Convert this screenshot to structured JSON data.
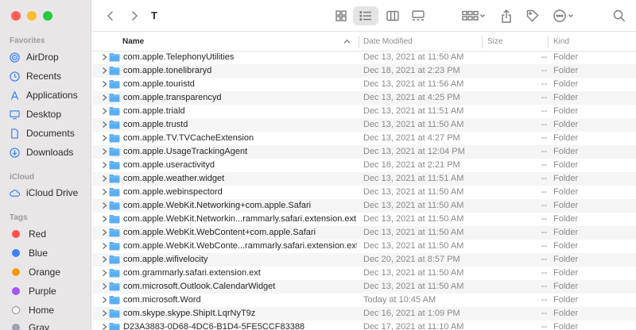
{
  "window": {
    "title": "T"
  },
  "sidebar": {
    "favorites_label": "Favorites",
    "favorites": [
      {
        "label": "AirDrop",
        "icon": "airdrop-icon"
      },
      {
        "label": "Recents",
        "icon": "clock-icon"
      },
      {
        "label": "Applications",
        "icon": "applications-icon"
      },
      {
        "label": "Desktop",
        "icon": "desktop-icon"
      },
      {
        "label": "Documents",
        "icon": "document-icon"
      },
      {
        "label": "Downloads",
        "icon": "download-icon"
      }
    ],
    "icloud_label": "iCloud",
    "icloud": [
      {
        "label": "iCloud Drive",
        "icon": "cloud-icon"
      }
    ],
    "tags_label": "Tags",
    "tags": [
      {
        "label": "Red",
        "color": "#ff4f4a"
      },
      {
        "label": "Blue",
        "color": "#3b82f6"
      },
      {
        "label": "Orange",
        "color": "#f59e0b"
      },
      {
        "label": "Purple",
        "color": "#a855f7"
      },
      {
        "label": "Home",
        "color": "#ffffff"
      },
      {
        "label": "Gray",
        "color": "#9ca3af"
      }
    ]
  },
  "columns": {
    "name": "Name",
    "date": "Date Modified",
    "size": "Size",
    "kind": "Kind"
  },
  "rows": [
    {
      "name": "com.apple.TelephonyUtilities",
      "date": "Dec 13, 2021 at 11:50 AM",
      "size": "--",
      "kind": "Folder"
    },
    {
      "name": "com.apple.tonelibraryd",
      "date": "Dec 18, 2021 at 2:23 PM",
      "size": "--",
      "kind": "Folder"
    },
    {
      "name": "com.apple.touristd",
      "date": "Dec 13, 2021 at 11:56 AM",
      "size": "--",
      "kind": "Folder"
    },
    {
      "name": "com.apple.transparencyd",
      "date": "Dec 13, 2021 at 4:25 PM",
      "size": "--",
      "kind": "Folder"
    },
    {
      "name": "com.apple.triald",
      "date": "Dec 13, 2021 at 11:51 AM",
      "size": "--",
      "kind": "Folder"
    },
    {
      "name": "com.apple.trustd",
      "date": "Dec 13, 2021 at 11:50 AM",
      "size": "--",
      "kind": "Folder"
    },
    {
      "name": "com.apple.TV.TVCacheExtension",
      "date": "Dec 13, 2021 at 4:27 PM",
      "size": "--",
      "kind": "Folder"
    },
    {
      "name": "com.apple.UsageTrackingAgent",
      "date": "Dec 13, 2021 at 12:04 PM",
      "size": "--",
      "kind": "Folder"
    },
    {
      "name": "com.apple.useractivityd",
      "date": "Dec 18, 2021 at 2:21 PM",
      "size": "--",
      "kind": "Folder"
    },
    {
      "name": "com.apple.weather.widget",
      "date": "Dec 13, 2021 at 11:51 AM",
      "size": "--",
      "kind": "Folder"
    },
    {
      "name": "com.apple.webinspectord",
      "date": "Dec 13, 2021 at 11:50 AM",
      "size": "--",
      "kind": "Folder"
    },
    {
      "name": "com.apple.WebKit.Networking+com.apple.Safari",
      "date": "Dec 13, 2021 at 11:50 AM",
      "size": "--",
      "kind": "Folder"
    },
    {
      "name": "com.apple.WebKit.Networkin...rammarly.safari.extension.ext",
      "date": "Dec 13, 2021 at 11:50 AM",
      "size": "--",
      "kind": "Folder"
    },
    {
      "name": "com.apple.WebKit.WebContent+com.apple.Safari",
      "date": "Dec 13, 2021 at 11:50 AM",
      "size": "--",
      "kind": "Folder"
    },
    {
      "name": "com.apple.WebKit.WebConte...rammarly.safari.extension.ext",
      "date": "Dec 13, 2021 at 11:50 AM",
      "size": "--",
      "kind": "Folder"
    },
    {
      "name": "com.apple.wifivelocity",
      "date": "Dec 20, 2021 at 8:57 PM",
      "size": "--",
      "kind": "Folder"
    },
    {
      "name": "com.grammarly.safari.extension.ext",
      "date": "Dec 13, 2021 at 11:50 AM",
      "size": "--",
      "kind": "Folder"
    },
    {
      "name": "com.microsoft.Outlook.CalendarWidget",
      "date": "Dec 13, 2021 at 11:50 AM",
      "size": "--",
      "kind": "Folder"
    },
    {
      "name": "com.microsoft.Word",
      "date": "Today at 10:45 AM",
      "size": "--",
      "kind": "Folder"
    },
    {
      "name": "com.skype.skype.ShipIt.LqrNyT9z",
      "date": "Dec 16, 2021 at 1:09 PM",
      "size": "--",
      "kind": "Folder"
    },
    {
      "name": "D23A3883-0D68-4DC6-B1D4-5FE5CCF83388",
      "date": "Dec 17, 2021 at 11:10 AM",
      "size": "--",
      "kind": "Folder"
    }
  ]
}
